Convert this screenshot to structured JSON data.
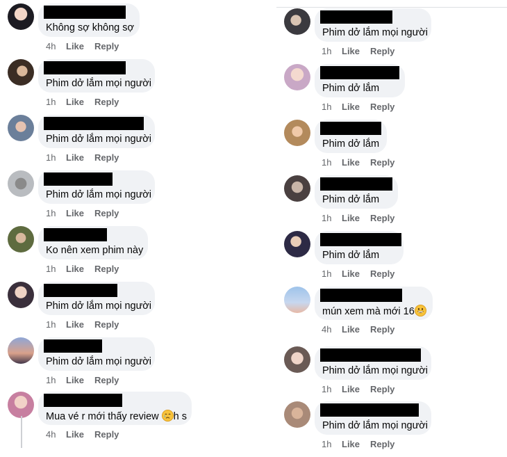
{
  "colors": {
    "bubble": "#f0f2f5",
    "name_redaction": "#000000",
    "meta_text": "#65676b",
    "comment_text": "#050505"
  },
  "left_column": [
    {
      "text": "Không sợ không sợ",
      "time": "4h",
      "like": "Like",
      "reply": "Reply"
    },
    {
      "text": "Phim dở lắm mọi người",
      "time": "1h",
      "like": "Like",
      "reply": "Reply"
    },
    {
      "text": "Phim dở lắm mọi người",
      "time": "1h",
      "like": "Like",
      "reply": "Reply"
    },
    {
      "text": "Phim dở lắm mọi người",
      "time": "1h",
      "like": "Like",
      "reply": "Reply"
    },
    {
      "text": "Ko nên xem phim này",
      "time": "1h",
      "like": "Like",
      "reply": "Reply"
    },
    {
      "text": "Phim dở lắm mọi người",
      "time": "1h",
      "like": "Like",
      "reply": "Reply"
    },
    {
      "text": "Phim dở lắm mọi người",
      "time": "1h",
      "like": "Like",
      "reply": "Reply"
    },
    {
      "text": "Mua vé r mới thấy review",
      "emoji": "crying-face-emoji",
      "text_after": "h s",
      "time": "4h",
      "like": "Like",
      "reply": "Reply"
    }
  ],
  "right_column": [
    {
      "text": "Phim dở lắm mọi người",
      "time": "1h",
      "like": "Like",
      "reply": "Reply"
    },
    {
      "text": "Phim dở lắm",
      "time": "1h",
      "like": "Like",
      "reply": "Reply"
    },
    {
      "text": "Phim dở lắm",
      "time": "1h",
      "like": "Like",
      "reply": "Reply"
    },
    {
      "text": "Phim dở lắm",
      "time": "1h",
      "like": "Like",
      "reply": "Reply"
    },
    {
      "text": "Phim dở lắm",
      "time": "1h",
      "like": "Like",
      "reply": "Reply"
    },
    {
      "text": "mún xem mà mới 16",
      "emoji": "grinning-face-emoji",
      "time": "4h",
      "like": "Like",
      "reply": "Reply"
    },
    {
      "text": "Phim dở lắm mọi người",
      "time": "1h",
      "like": "Like",
      "reply": "Reply"
    },
    {
      "text": "Phim dở lắm mọi người",
      "time": "1h",
      "like": "Like",
      "reply": "Reply"
    }
  ]
}
